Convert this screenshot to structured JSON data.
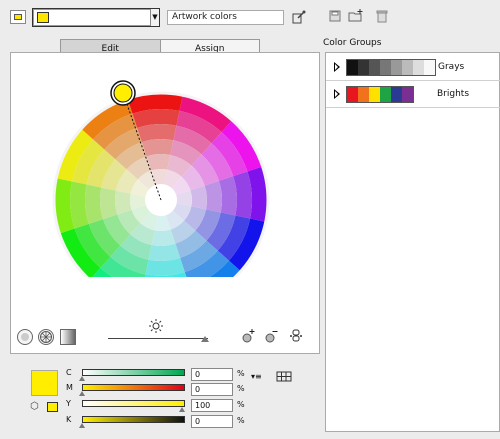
{
  "top_bar": {
    "artwork_field_value": "Artwork colors"
  },
  "tabs": [
    {
      "label": "Edit"
    },
    {
      "label": "Assign"
    }
  ],
  "color_groups": {
    "header": "Color Groups",
    "groups": [
      {
        "name": "Grays",
        "swatches": [
          "#111111",
          "#333333",
          "#555555",
          "#777777",
          "#999999",
          "#bbbbbb",
          "#dddddd",
          "#f8f8f8"
        ]
      },
      {
        "name": "Brights",
        "swatches": [
          "#e8161e",
          "#f2711c",
          "#ffe100",
          "#1ea345",
          "#2b3a92",
          "#7a2f92"
        ]
      }
    ]
  },
  "channels": [
    {
      "label": "C",
      "value": "0",
      "unit": "%",
      "gradient": [
        "#ffffff",
        "#00a651"
      ]
    },
    {
      "label": "M",
      "value": "0",
      "unit": "%",
      "gradient": [
        "#ffee00",
        "#e2001a"
      ]
    },
    {
      "label": "Y",
      "value": "100",
      "unit": "%",
      "gradient": [
        "#ffffff",
        "#ffee00"
      ]
    },
    {
      "label": "K",
      "value": "0",
      "unit": "%",
      "gradient": [
        "#ffee00",
        "#111111"
      ]
    }
  ],
  "selected_color": "#ffee00",
  "icons": {
    "pick": "eyedropper-icon",
    "save": "save-icon",
    "new_group": "new-group-icon",
    "delete": "trash-icon",
    "brightness": "sun-icon",
    "add_color": "add-color-icon",
    "remove_color": "remove-color-icon",
    "link": "link-colors-icon"
  }
}
